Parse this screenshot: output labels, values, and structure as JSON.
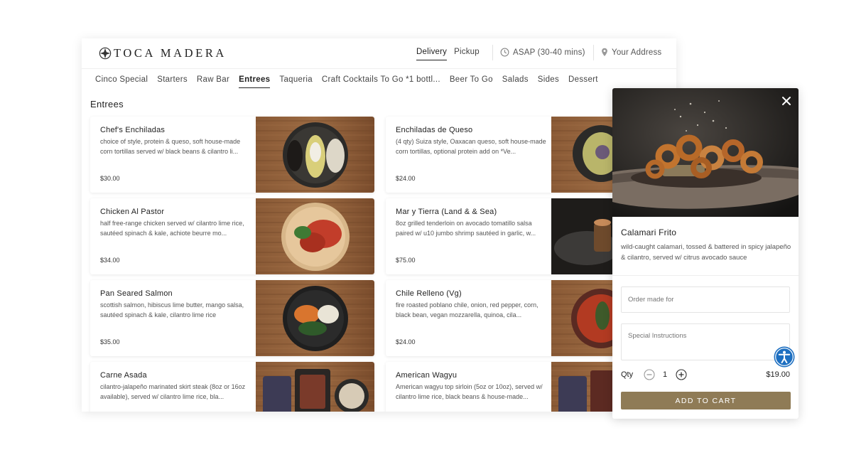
{
  "brand": {
    "name": "TOCA MADERA"
  },
  "header": {
    "modes": [
      {
        "label": "Delivery",
        "active": true
      },
      {
        "label": "Pickup",
        "active": false
      }
    ],
    "time_label": "ASAP (30-40 mins)",
    "address_label": "Your Address"
  },
  "categories": [
    {
      "label": "Cinco Special"
    },
    {
      "label": "Starters"
    },
    {
      "label": "Raw Bar"
    },
    {
      "label": "Entrees",
      "active": true
    },
    {
      "label": "Taqueria"
    },
    {
      "label": "Craft Cocktails To Go *1 bottl..."
    },
    {
      "label": "Beer To Go"
    },
    {
      "label": "Salads"
    },
    {
      "label": "Sides"
    },
    {
      "label": "Dessert"
    }
  ],
  "section": {
    "title": "Entrees"
  },
  "menu": [
    {
      "name": "Chef's Enchiladas",
      "desc": "choice of style, protein & queso, soft house-made corn tortillas served w/ black beans & cilantro li...",
      "price": "$30.00"
    },
    {
      "name": "Enchiladas de Queso",
      "desc": "(4 qty) Suiza style, Oaxacan queso, soft house-made corn tortillas, optional protein add on *Ve...",
      "price": "$24.00"
    },
    {
      "name": "Chicken Al Pastor",
      "desc": "half free-range chicken served w/ cilantro lime rice, sautéed spinach & kale, achiote beurre mo...",
      "price": "$34.00"
    },
    {
      "name": "Mar y Tierra (Land & & Sea)",
      "desc": "8oz grilled tenderloin on avocado tomatillo salsa paired w/ u10 jumbo shrimp sautéed in garlic, w...",
      "price": "$75.00"
    },
    {
      "name": "Pan Seared Salmon",
      "desc": "scottish salmon, hibiscus lime butter, mango salsa, sautéed spinach & kale, cilantro lime rice",
      "price": "$35.00"
    },
    {
      "name": "Chile Relleno (Vg)",
      "desc": "fire roasted poblano chile, onion, red pepper, corn, black bean, vegan mozzarella, quinoa, cila...",
      "price": "$24.00"
    },
    {
      "name": "Carne Asada",
      "desc": "cilantro-jalapeño marinated skirt steak (8oz or 16oz available), served w/ cilantro lime rice, bla...",
      "price": ""
    },
    {
      "name": "American Wagyu",
      "desc": "American wagyu top sirloin (5oz or 10oz), served w/ cilantro lime rice, black beans & house-made...",
      "price": ""
    }
  ],
  "modal": {
    "title": "Calamari Frito",
    "desc": "wild-caught calamari, tossed & battered in spicy jalapeño & cilantro, served w/ citrus avocado sauce",
    "order_for_placeholder": "Order made for",
    "instructions_placeholder": "Special Instructions",
    "qty_label": "Qty",
    "qty": "1",
    "total": "$19.00",
    "add_button": "ADD TO CART"
  },
  "colors": {
    "accent": "#8f7b56",
    "a11y": "#1d6fc1"
  },
  "icons": [
    "logo-mark-icon",
    "clock-icon",
    "location-pin-icon",
    "close-icon",
    "minus-circle-icon",
    "plus-circle-icon",
    "accessibility-icon"
  ]
}
